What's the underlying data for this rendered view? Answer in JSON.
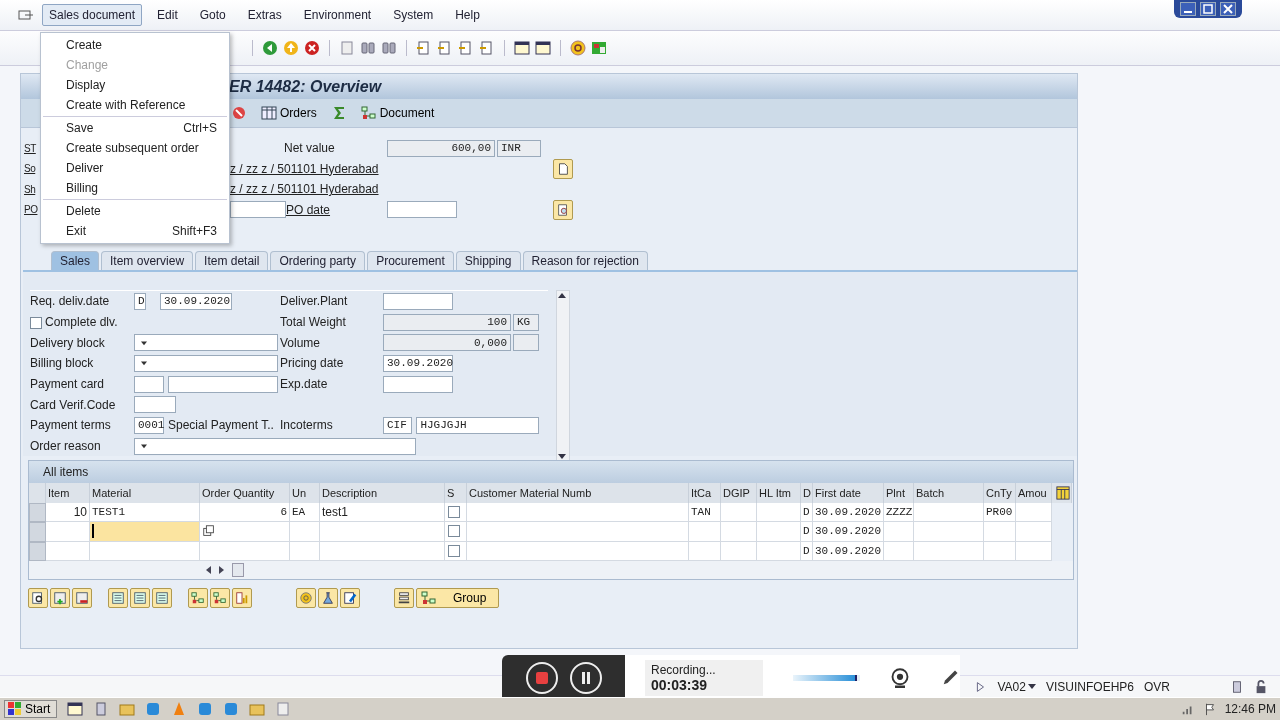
{
  "window": {
    "title": "ER 14482: Overview"
  },
  "menu_bar": [
    {
      "label": "Sales document",
      "selected": true
    },
    {
      "label": "Edit",
      "selected": false
    },
    {
      "label": "Goto",
      "selected": false
    },
    {
      "label": "Extras",
      "selected": false
    },
    {
      "label": "Environment",
      "selected": false
    },
    {
      "label": "System",
      "selected": false
    },
    {
      "label": "Help",
      "selected": false
    }
  ],
  "dropdown": {
    "groups": [
      {
        "items": [
          {
            "label": "Create",
            "disabled": false
          },
          {
            "label": "Change",
            "disabled": true
          },
          {
            "label": "Display",
            "disabled": false
          },
          {
            "label": "Create with Reference",
            "disabled": false
          }
        ]
      },
      {
        "items": [
          {
            "label": "Save",
            "shortcut": "Ctrl+S",
            "disabled": false
          },
          {
            "label": "Create subsequent order",
            "disabled": false
          },
          {
            "label": "Deliver",
            "disabled": false
          },
          {
            "label": "Billing",
            "disabled": false
          }
        ]
      },
      {
        "items": [
          {
            "label": "Delete",
            "disabled": false
          },
          {
            "label": "Exit",
            "shortcut": "Shift+F3",
            "disabled": false
          }
        ]
      }
    ]
  },
  "app_toolbar": {
    "buttons": [
      {
        "label": "Orders"
      },
      {
        "label": "Document"
      }
    ]
  },
  "header": {
    "rows": [
      {
        "kind": "value",
        "label_fragment": "ST",
        "field_label": "Net value",
        "value": "600,00",
        "unit": "INR"
      },
      {
        "kind": "address",
        "label_fragment": "So",
        "address": "z / zz z / 501101 Hyderabad"
      },
      {
        "kind": "address",
        "label_fragment": "Sh",
        "address": "z / zz z / 501101 Hyderabad"
      },
      {
        "kind": "po",
        "label_fragment": "PO",
        "field_label": "PO date"
      }
    ]
  },
  "tabs": [
    {
      "label": "Sales",
      "selected": true
    },
    {
      "label": "Item overview",
      "selected": false
    },
    {
      "label": "Item detail",
      "selected": false
    },
    {
      "label": "Ordering party",
      "selected": false
    },
    {
      "label": "Procurement",
      "selected": false
    },
    {
      "label": "Shipping",
      "selected": false
    },
    {
      "label": "Reason for rejection",
      "selected": false
    }
  ],
  "sales_fields": [
    {
      "left": {
        "kind": "date",
        "label": "Req. deliv.date",
        "prefix": "D",
        "value": "30.09.2020"
      },
      "right": {
        "kind": "field",
        "label": "Deliver.Plant"
      }
    },
    {
      "left": {
        "kind": "checkbox",
        "label": "Complete dlv.",
        "checked": false
      },
      "right": {
        "kind": "readonly",
        "label": "Total Weight",
        "value": "100",
        "unit": "KG"
      }
    },
    {
      "left": {
        "kind": "dropdown",
        "label": "Delivery block"
      },
      "right": {
        "kind": "readonly",
        "label": "Volume",
        "value": "0,000"
      }
    },
    {
      "left": {
        "kind": "dropdown",
        "label": "Billing block"
      },
      "right": {
        "kind": "field",
        "label": "Pricing date",
        "value": "30.09.2020"
      }
    },
    {
      "left": {
        "kind": "pair",
        "label": "Payment card"
      },
      "right": {
        "kind": "field",
        "label": "Exp.date"
      }
    },
    {
      "left": {
        "kind": "field",
        "label": "Card Verif.Code"
      }
    },
    {
      "left": {
        "kind": "code",
        "label": "Payment terms",
        "code": "0001",
        "text": "Special Payment T.."
      },
      "right": {
        "kind": "code",
        "label": "Incoterms",
        "code": "CIF",
        "text": "HJGJGJH"
      }
    },
    {
      "left": {
        "kind": "wide_dropdown",
        "label": "Order reason"
      }
    }
  ],
  "items_table": {
    "title": "All items",
    "columns": [
      "Item",
      "Material",
      "Order Quantity",
      "Un",
      "Description",
      "S",
      "Customer Material Numb",
      "ItCa",
      "DGIP",
      "HL Itm",
      "D",
      "First date",
      "Plnt",
      "Batch",
      "CnTy",
      "Amou"
    ],
    "rows": [
      {
        "cells": [
          "10",
          "TEST1",
          "6",
          "EA",
          "test1",
          null,
          null,
          "TAN",
          null,
          null,
          "D",
          "30.09.2020",
          "ZZZZ",
          null,
          "PR00",
          null
        ],
        "s_checked": false,
        "editing": false
      },
      {
        "cells": [
          null,
          null,
          null,
          null,
          null,
          null,
          null,
          null,
          null,
          null,
          "D",
          "30.09.2020",
          null,
          null,
          null,
          null
        ],
        "s_checked": false,
        "editing": true
      },
      {
        "cells": [
          null,
          null,
          null,
          null,
          null,
          null,
          null,
          null,
          null,
          null,
          "D",
          "30.09.2020",
          null,
          null,
          null,
          null
        ],
        "s_checked": false,
        "editing": false
      }
    ]
  },
  "bottom_toolbar": {
    "group_button": "Group"
  },
  "status_bar": {
    "transaction": "VA02",
    "server": "VISUINFOEHP6",
    "mode": "OVR"
  },
  "recorder": {
    "status": "Recording...",
    "time": "00:03:39",
    "volume": {
      "level": 0.95
    }
  },
  "taskbar": {
    "start": "Start",
    "clock": "12:46 PM"
  }
}
